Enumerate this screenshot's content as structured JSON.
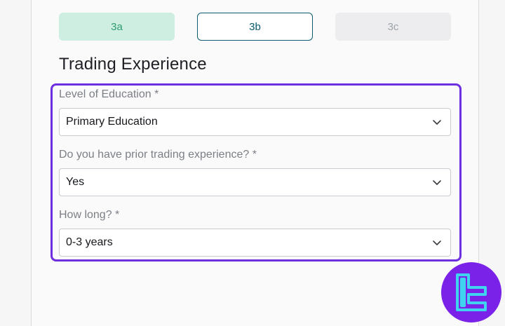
{
  "steps": [
    {
      "label": "3a",
      "state": "completed"
    },
    {
      "label": "3b",
      "state": "active"
    },
    {
      "label": "3c",
      "state": "inactive"
    }
  ],
  "section": {
    "title": "Trading Experience"
  },
  "form": {
    "education": {
      "label": "Level of Education *",
      "value": "Primary Education"
    },
    "prior_experience": {
      "label": "Do you have prior trading experience? *",
      "value": "Yes"
    },
    "duration": {
      "label": "How long? *",
      "value": "0-3 years"
    }
  },
  "colors": {
    "highlight_border": "#6d2fe0",
    "active_step": "#0b5a6e",
    "completed_step_bg": "#cdeee0",
    "logo_bg": "#7b22e8",
    "logo_glyph": "#3fd3f0"
  },
  "icons": {
    "select_chevron": "chevron-down-icon",
    "brand": "brand-logo-icon"
  }
}
